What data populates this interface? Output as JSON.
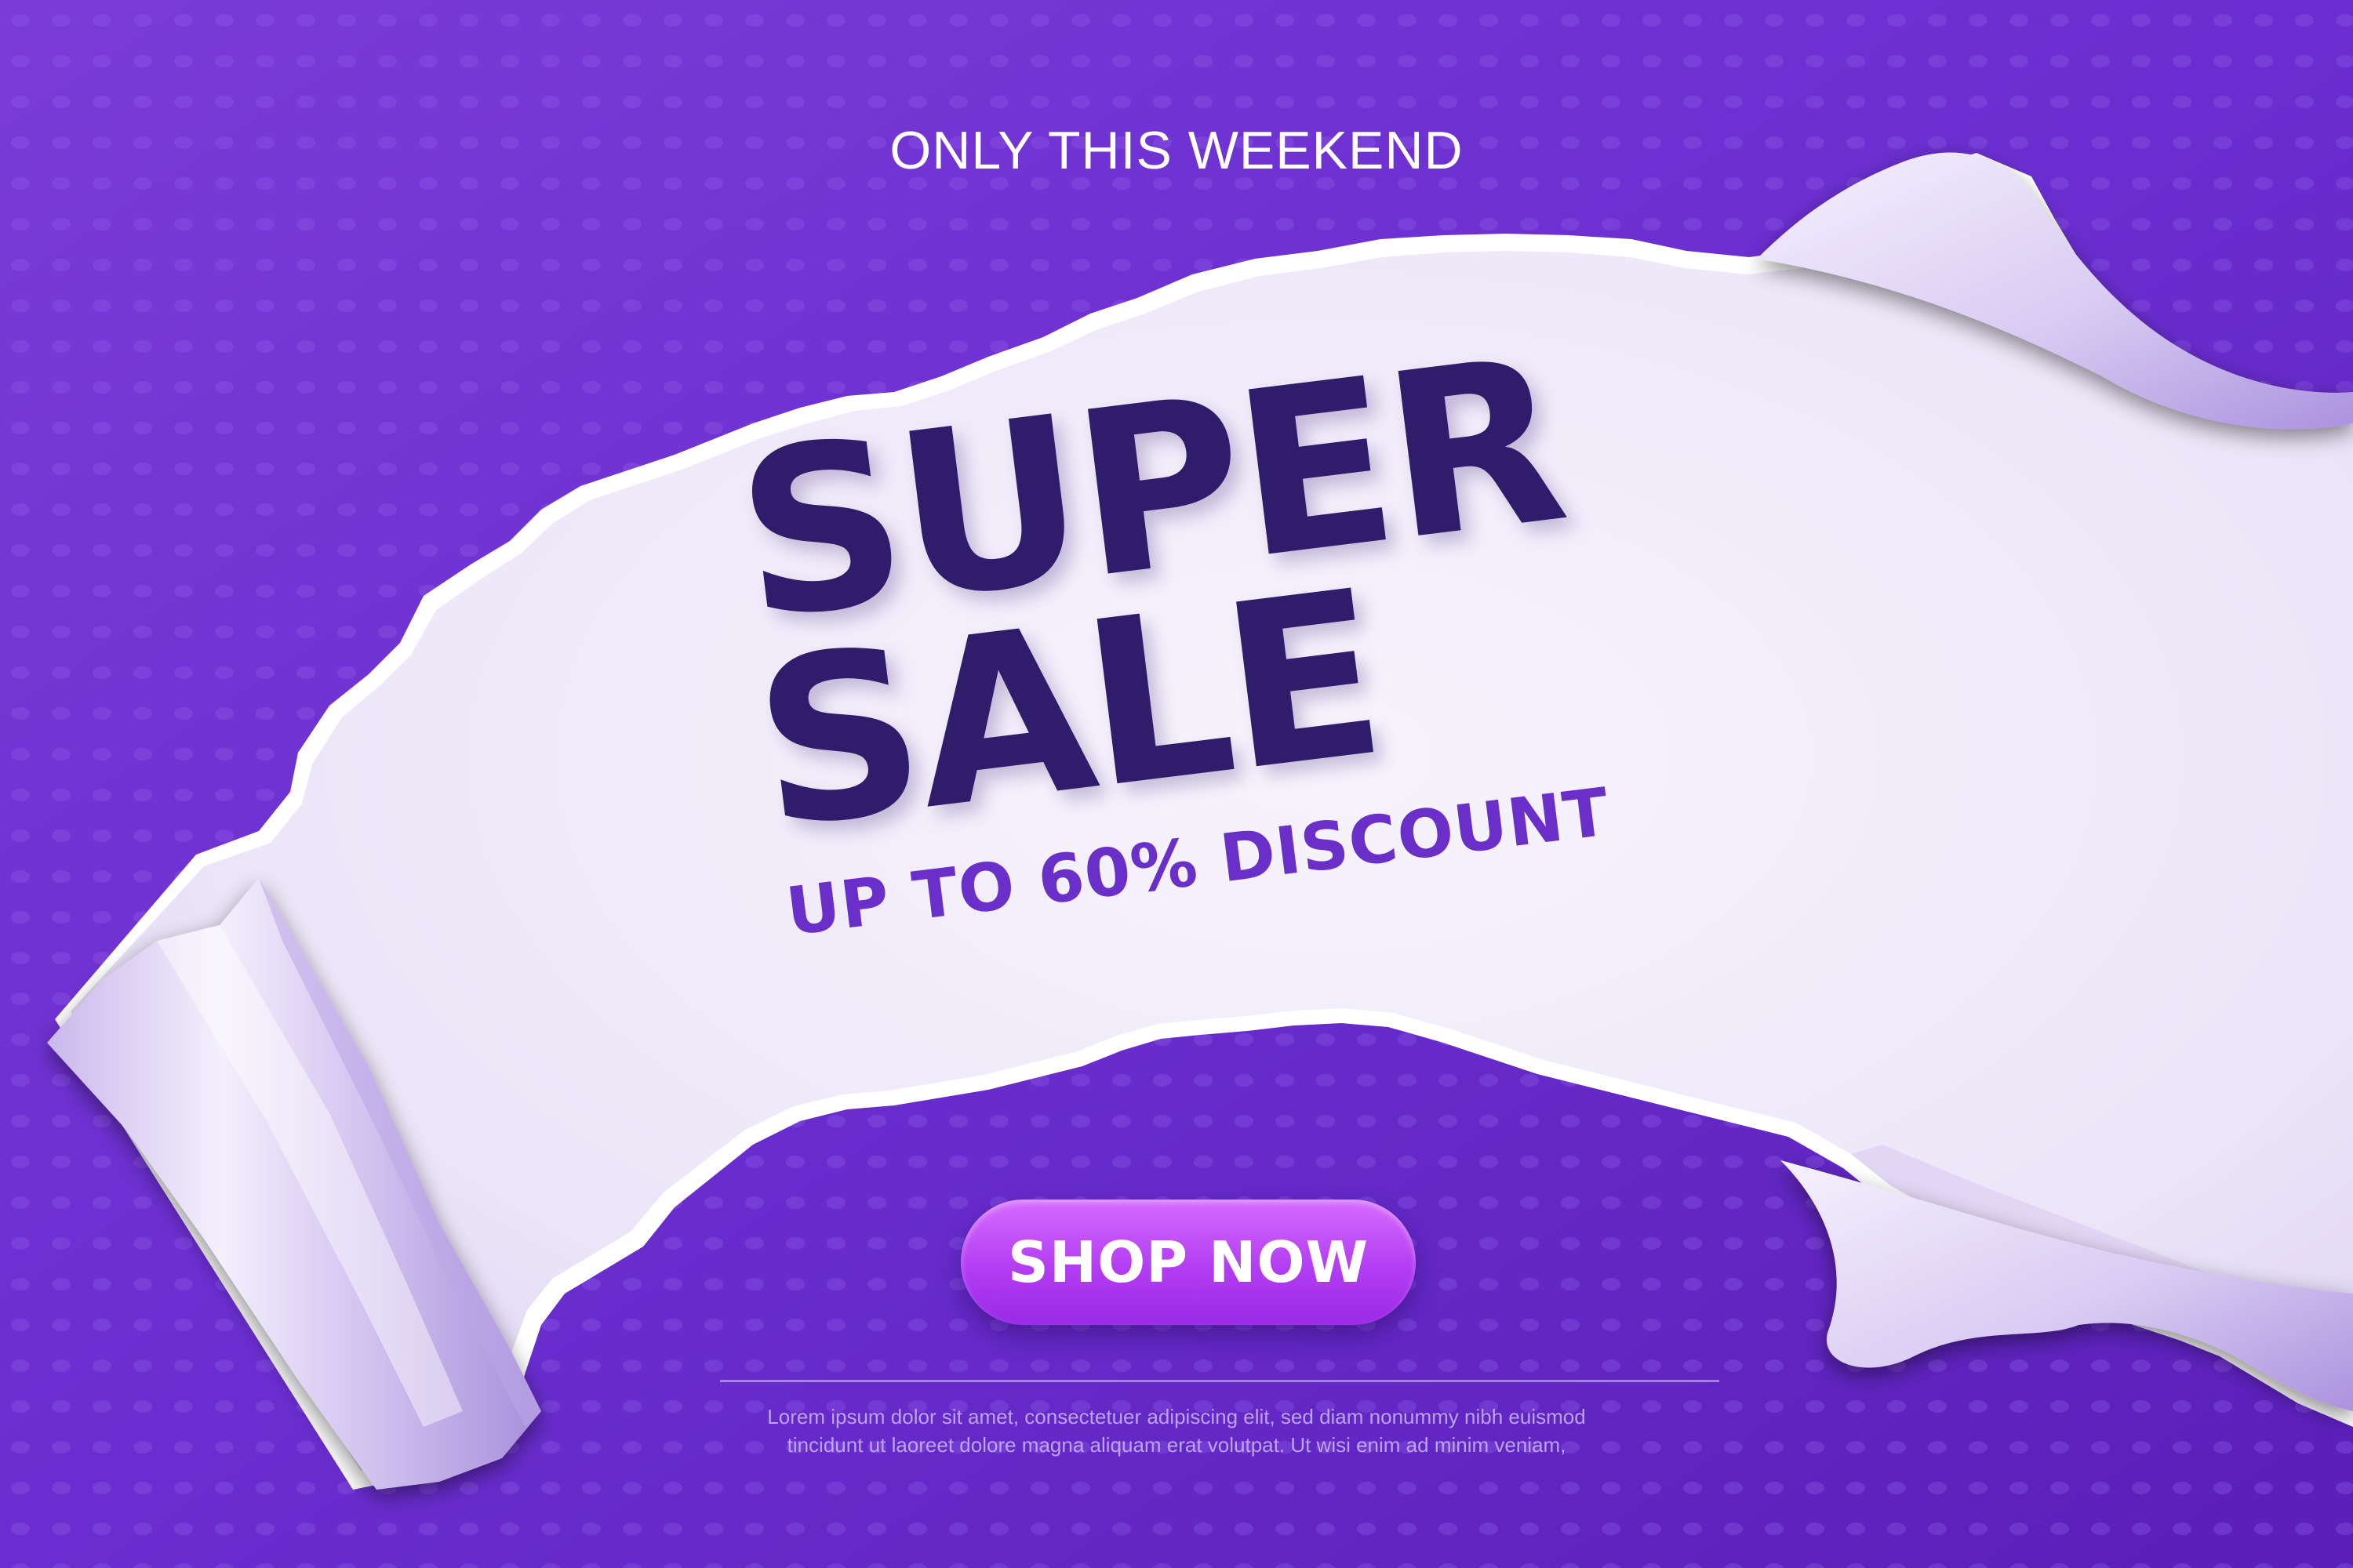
{
  "banner": {
    "top_tagline": "ONLY THIS WEEKEND",
    "headline_line1": "SUPER",
    "headline_line2": "SALE",
    "discount": "UP TO 60% DISCOUNT",
    "cta_label": "SHOP NOW",
    "body_text_line1": "Lorem ipsum dolor sit amet, consectetuer adipiscing elit, sed diam nonummy nibh euismod",
    "body_text_line2": "tincidunt ut laoreet dolore magna aliquam erat volutpat. Ut wisi enim ad minim veniam,"
  },
  "colors": {
    "background_purple": "#6a2ed0",
    "paper": "#f1ecfb",
    "headline": "#2f1d6b",
    "discount": "#6a2fc8",
    "button_gradient_top": "#d66cff",
    "button_gradient_bottom": "#9a2ae6",
    "text_white": "#ffffff"
  },
  "icons": {
    "torn_paper": "torn-paper-graphic",
    "paper_roll_left": "paper-roll-curl",
    "paper_curl_right": "paper-curl-corner"
  }
}
